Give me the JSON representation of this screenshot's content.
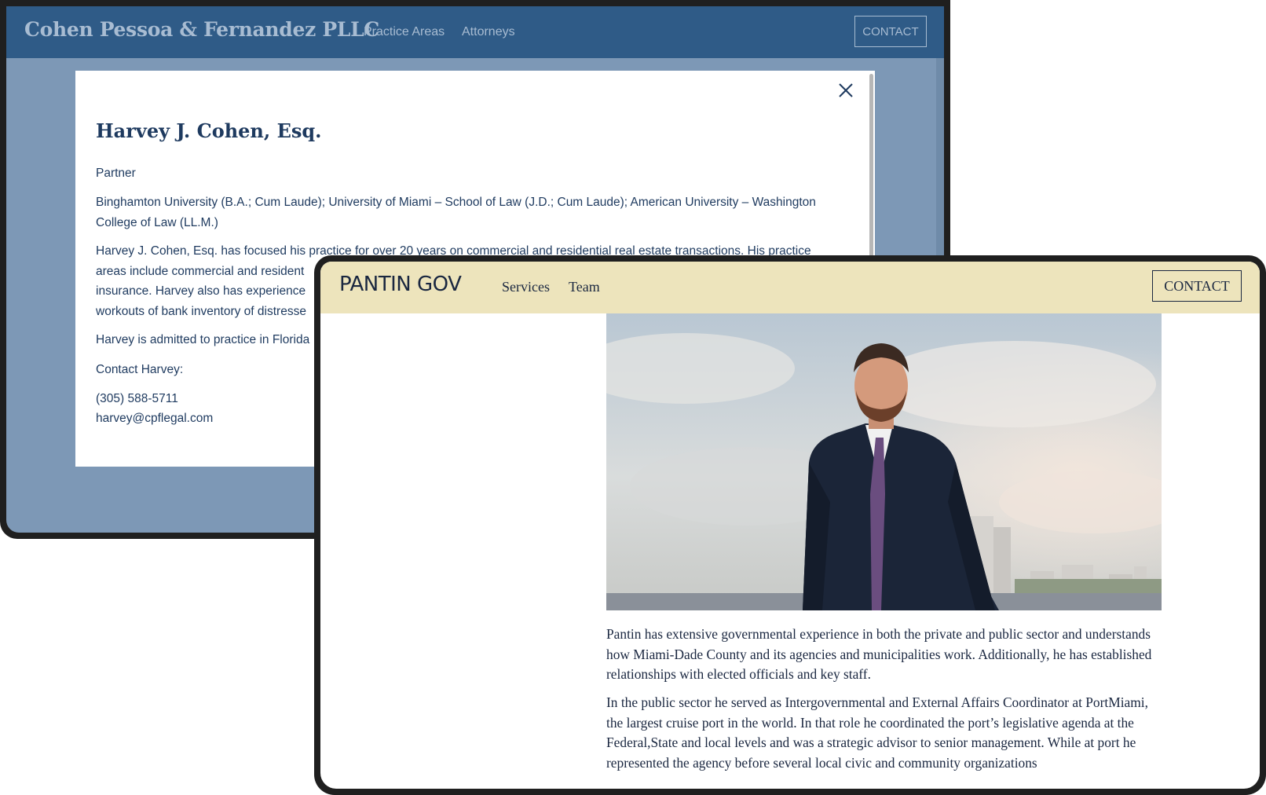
{
  "back_site": {
    "logo": "Cohen Pessoa & Fernandez PLLC",
    "nav": [
      "Practice Areas",
      "Attorneys"
    ],
    "contact_button": "CONTACT",
    "modal": {
      "close_icon": "close-icon",
      "name": "Harvey J. Cohen, Esq.",
      "role": "Partner",
      "education": "Binghamton University (B.A.; Cum Laude); University of Miami – School of Law (J.D.; Cum Laude); American University – Washington College of Law (LL.M.)",
      "bio_lines": [
        "Harvey J. Cohen, Esq. has focused his practice for over 20 years on commercial and residential real estate transactions. His practice",
        "areas include commercial and resident",
        "insurance. Harvey also has experience",
        "workouts of bank inventory of distresse"
      ],
      "admitted": "Harvey is admitted to practice in Florida",
      "contact_label": "Contact Harvey:",
      "phone": "(305) 588-5711",
      "email": "harvey@cpflegal.com"
    }
  },
  "front_site": {
    "logo": "PANTIN GOV",
    "nav": [
      "Services",
      "Team"
    ],
    "contact_button": "CONTACT",
    "hero_image": "portrait-photo",
    "paragraph_1": "Pantin has extensive governmental experience in both the private and public sector and understands how Miami-Dade County and its agencies and municipalities work. Additionally, he has established relationships with elected officials and key staff.",
    "paragraph_2": "In the public sector he served as Intergovernmental and External Affairs Coordinator at PortMiami, the largest cruise port in the world. In that role he coordinated the port’s legislative agenda at the Federal,State and local levels and was a strategic advisor to senior management. While at port he represented the agency before several local civic and community organizations"
  },
  "colors": {
    "back_header": "#2f5b87",
    "back_overlay": "#7d98b6",
    "navy_text": "#1e3a5f",
    "front_header": "#ede4bc",
    "front_text": "#1a2740"
  }
}
